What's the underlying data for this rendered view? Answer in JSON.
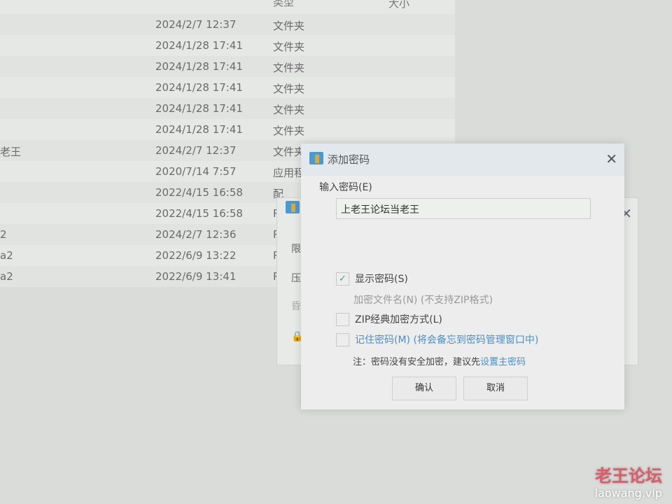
{
  "list": {
    "headers": {
      "type": "类型",
      "size": "大小"
    },
    "rows": [
      {
        "name": "",
        "date": "2024/2/7 12:37",
        "type": "文件夹"
      },
      {
        "name": "",
        "date": "2024/1/28 17:41",
        "type": "文件夹"
      },
      {
        "name": "",
        "date": "2024/1/28 17:41",
        "type": "文件夹"
      },
      {
        "name": "",
        "date": "2024/1/28 17:41",
        "type": "文件夹"
      },
      {
        "name": "",
        "date": "2024/1/28 17:41",
        "type": "文件夹"
      },
      {
        "name": "",
        "date": "2024/1/28 17:41",
        "type": "文件夹"
      },
      {
        "name": "老王",
        "date": "2024/2/7 12:37",
        "type": "文件夹"
      },
      {
        "name": "",
        "date": "2020/7/14 7:57",
        "type": "应用程"
      },
      {
        "name": "",
        "date": "2022/4/15 16:58",
        "type": "配"
      },
      {
        "name": "",
        "date": "2022/4/15 16:58",
        "type": "R"
      },
      {
        "name": "2",
        "date": "2024/2/7 12:36",
        "type": "R"
      },
      {
        "name": "a2",
        "date": "2022/6/9 13:22",
        "type": "R"
      },
      {
        "name": "a2",
        "date": "2022/6/9 13:41",
        "type": "R"
      }
    ]
  },
  "bg_dialog": {
    "items": [
      "限",
      "压",
      "昏"
    ]
  },
  "dialog": {
    "title": "添加密码",
    "password_label": "输入密码(E)",
    "password_value": "上老王论坛当老王",
    "show_password": {
      "label": "显示密码(S)",
      "checked": true
    },
    "encrypt_names": {
      "label": "加密文件名(N) (不支持ZIP格式)"
    },
    "zip_classic": {
      "label": "ZIP经典加密方式(L)",
      "checked": false
    },
    "remember": {
      "label": "记住密码(M) (将会备忘到密码管理窗口中)",
      "checked": false
    },
    "note": "注：密码没有安全加密，建议先",
    "note_link": "设置主密码",
    "ok": "确认",
    "cancel": "取消",
    "accent": "#2e8fd6"
  },
  "watermark": {
    "cn": "老王论坛",
    "url": "laowang.vip"
  }
}
